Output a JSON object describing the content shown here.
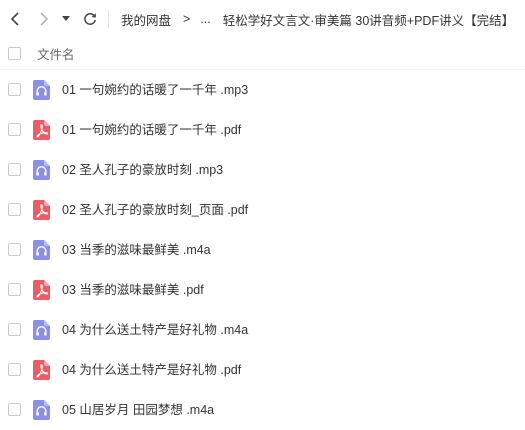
{
  "toolbar": {
    "back_icon": "chevron-left-icon",
    "forward_icon": "chevron-right-icon",
    "dropdown_icon": "caret-down-icon",
    "refresh_icon": "refresh-icon"
  },
  "breadcrumb": {
    "root": "我的网盘",
    "separator": ">",
    "ellipsis": "...",
    "current": "轻松学好文言文·审美篇 30讲音频+PDF讲义【完结】",
    "extra": "【 】"
  },
  "header": {
    "column_label": "文件名"
  },
  "colors": {
    "audio_icon": "#8c8fe6",
    "pdf_icon": "#f05a67"
  },
  "files": [
    {
      "name": "01 一句婉约的话暖了一千年 .mp3",
      "type": "audio"
    },
    {
      "name": "01 一句婉约的话暖了一千年 .pdf",
      "type": "pdf"
    },
    {
      "name": "02 圣人孔子的豪放时刻 .mp3",
      "type": "audio"
    },
    {
      "name": "02 圣人孔子的豪放时刻_页面 .pdf",
      "type": "pdf"
    },
    {
      "name": "03 当季的滋味最鲜美 .m4a",
      "type": "audio"
    },
    {
      "name": "03 当季的滋味最鲜美 .pdf",
      "type": "pdf"
    },
    {
      "name": "04 为什么送土特产是好礼物 .m4a",
      "type": "audio"
    },
    {
      "name": "04 为什么送土特产是好礼物 .pdf",
      "type": "pdf"
    },
    {
      "name": "05 山居岁月 田园梦想 .m4a",
      "type": "audio"
    }
  ]
}
